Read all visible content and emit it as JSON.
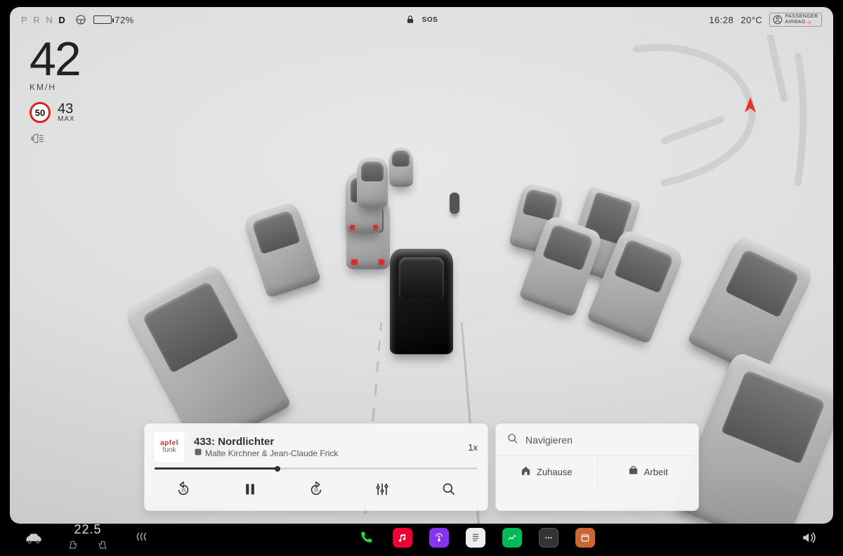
{
  "status": {
    "gears": [
      "P",
      "R",
      "N",
      "D"
    ],
    "active_gear": "D",
    "battery_pct": 72,
    "battery_label": "72%",
    "sos": "SOS",
    "time": "16:28",
    "temp_out": "20°C",
    "airbag_line1": "PASSENGER",
    "airbag_line2": "AIRBAG"
  },
  "speed": {
    "value": "42",
    "unit": "KM/H",
    "limit": "50",
    "max_value": "43",
    "max_label": "MAX"
  },
  "media": {
    "art_top": "apfel",
    "art_bottom": "funk",
    "title": "433: Nordlichter",
    "subtitle": "Malte Kirchner & Jean-Claude Frick",
    "speed": "1x",
    "progress_pct": 38
  },
  "nav": {
    "search_placeholder": "Navigieren",
    "dest_home": "Zuhause",
    "dest_work": "Arbeit"
  },
  "dock": {
    "cabin_temp": "22.5"
  },
  "colors": {
    "limit_ring": "#d22222",
    "compass": "#e5332a"
  }
}
